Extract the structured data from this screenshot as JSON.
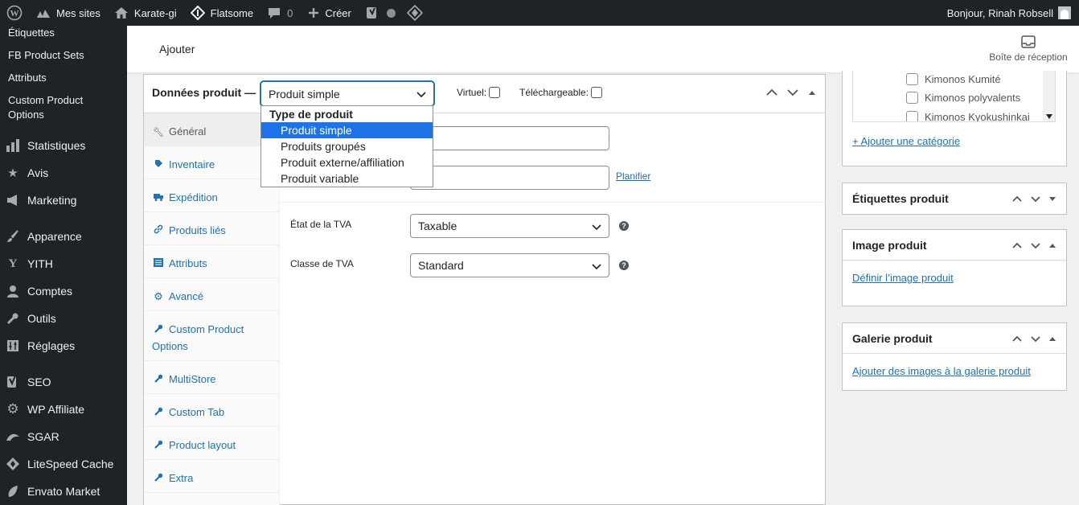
{
  "adminbar": {
    "wp_logo": "wordpress-icon",
    "mes_sites": "Mes sites",
    "site_name": "Karate-gi",
    "theme": "Flatsome",
    "comments_count": "0",
    "create": "Créer",
    "greeting": "Bonjour, Rinah Robsell"
  },
  "sidebar": {
    "submenu": [
      "Étiquettes",
      "FB Product Sets",
      "Attributs",
      "Custom Product Options"
    ],
    "menu": [
      "Statistiques",
      "Avis",
      "Marketing",
      "Apparence",
      "YITH",
      "Comptes",
      "Outils",
      "Réglages",
      "SEO",
      "WP Affiliate",
      "SGAR",
      "LiteSpeed Cache",
      "Envato Market"
    ]
  },
  "header": {
    "add": "Ajouter",
    "inbox": "Boîte de réception"
  },
  "product_data": {
    "title": "Données produit —",
    "type_selected": "Produit simple",
    "virtual_label": "Virtuel:",
    "downloadable_label": "Téléchargeable:",
    "dropdown": {
      "group": "Type de produit",
      "options": [
        "Produit simple",
        "Produits groupés",
        "Produit externe/affiliation",
        "Produit variable"
      ]
    },
    "tabs": [
      "Général",
      "Inventaire",
      "Expédition",
      "Produits liés",
      "Attributs",
      "Avancé",
      "Custom Product Options",
      "MultiStore",
      "Custom Tab",
      "Product layout",
      "Extra"
    ],
    "schedule_link": "Planifier",
    "tax_status_label": "État de la TVA",
    "tax_status_value": "Taxable",
    "tax_class_label": "Classe de TVA",
    "tax_class_value": "Standard"
  },
  "categories_box": {
    "items": [
      "Kimonos Kumité",
      "Kimonos polyvalents",
      "Kimonos Kyokushinkai"
    ],
    "add_link": "+ Ajouter une catégorie"
  },
  "tags_box": {
    "title": "Étiquettes produit"
  },
  "image_box": {
    "title": "Image produit",
    "link": "Définir l’image produit"
  },
  "gallery_box": {
    "title": "Galerie produit",
    "link": "Ajouter des images à la galerie produit"
  }
}
